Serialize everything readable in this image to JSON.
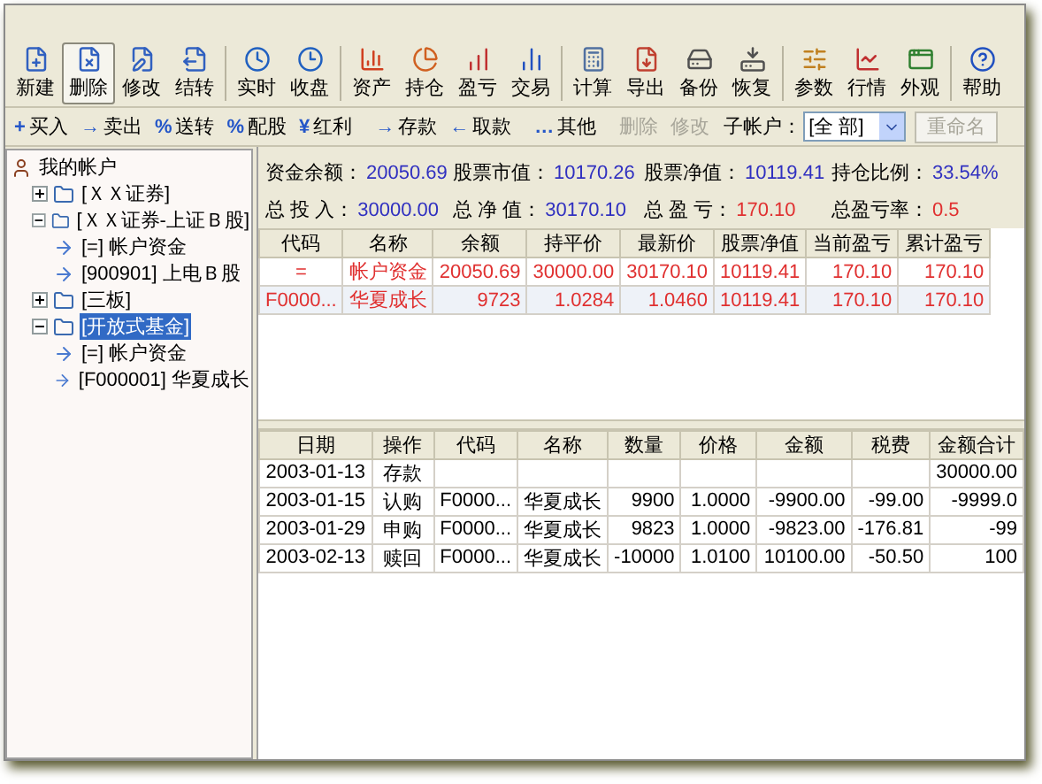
{
  "toolbar": [
    [
      {
        "label": "新建",
        "pressed": false
      },
      {
        "label": "删除",
        "pressed": true
      },
      {
        "label": "修改",
        "pressed": false
      },
      {
        "label": "结转",
        "pressed": false
      }
    ],
    [
      {
        "label": "实时",
        "pressed": false
      },
      {
        "label": "收盘",
        "pressed": false
      }
    ],
    [
      {
        "label": "资产",
        "pressed": false
      },
      {
        "label": "持仓",
        "pressed": false
      },
      {
        "label": "盈亏",
        "pressed": false
      },
      {
        "label": "交易",
        "pressed": false
      }
    ],
    [
      {
        "label": "计算",
        "pressed": false
      },
      {
        "label": "导出",
        "pressed": false
      },
      {
        "label": "备份",
        "pressed": false
      },
      {
        "label": "恢复",
        "pressed": false
      }
    ],
    [
      {
        "label": "参数",
        "pressed": false
      },
      {
        "label": "行情",
        "pressed": false
      },
      {
        "label": "外观",
        "pressed": false
      }
    ],
    [
      {
        "label": "帮助",
        "pressed": false
      }
    ]
  ],
  "actions": [
    [
      {
        "glyph": "+",
        "label": "买入",
        "disabled": false
      },
      {
        "glyph": "→",
        "label": "卖出",
        "disabled": false
      },
      {
        "glyph": "%",
        "label": "送转",
        "disabled": false
      },
      {
        "glyph": "%",
        "label": "配股",
        "disabled": false
      },
      {
        "glyph": "¥",
        "label": "红利",
        "disabled": false
      }
    ],
    [
      {
        "glyph": "→",
        "label": "存款",
        "disabled": false
      },
      {
        "glyph": "←",
        "label": "取款",
        "disabled": false
      }
    ],
    [
      {
        "glyph": "…",
        "label": "其他",
        "disabled": false
      }
    ],
    [
      {
        "label": "删除",
        "disabled": true
      },
      {
        "label": "修改",
        "disabled": true
      }
    ]
  ],
  "sub_account": {
    "label": "子帐户：",
    "value": "[全  部]",
    "rename": "重命名",
    "rename_disabled": true
  },
  "tree": [
    {
      "label": "我的帐户",
      "kind": "root",
      "selected": false,
      "children": [
        {
          "label": "[ＸＸ证券]",
          "kind": "account",
          "selected": false,
          "expanded": false
        },
        {
          "label": "[ＸＸ证券-上证Ｂ股]",
          "kind": "account",
          "selected": false,
          "expanded": true,
          "children": [
            {
              "label": "[=] 帐户资金",
              "kind": "item",
              "selected": false
            },
            {
              "label": "[900901] 上电Ｂ股",
              "kind": "item",
              "selected": false
            }
          ]
        },
        {
          "label": "[三板]",
          "kind": "account",
          "selected": false,
          "expanded": false
        },
        {
          "label": "[开放式基金]",
          "kind": "account",
          "selected": true,
          "expanded": true,
          "children": [
            {
              "label": "[=] 帐户资金",
              "kind": "item",
              "selected": false
            },
            {
              "label": "[F000001] 华夏成长",
              "kind": "item",
              "selected": false
            }
          ]
        }
      ]
    }
  ],
  "summary": [
    [
      {
        "label": "资金余额：",
        "value": "20050.69",
        "kind": "plain"
      },
      {
        "label": "股票市值：",
        "value": "10170.26",
        "kind": "plain"
      },
      {
        "label": "股票净值：",
        "value": "10119.41",
        "kind": "plain"
      },
      {
        "label": "持仓比例：",
        "value": "33.54%",
        "kind": "plain"
      }
    ],
    [
      {
        "label": "总 投 入：",
        "value": "30000.00",
        "kind": "plain"
      },
      {
        "label": "总 净 值：",
        "value": "30170.10",
        "kind": "plain"
      },
      {
        "label": "总 盈 亏：",
        "value": "170.10",
        "kind": "gain"
      },
      {
        "label": "总盈亏率：",
        "value": "0.5",
        "kind": "gain"
      }
    ]
  ],
  "holdings": {
    "columns": [
      "代码",
      "名称",
      "余额",
      "持平价",
      "最新价",
      "股票净值",
      "当前盈亏",
      "累计盈亏"
    ],
    "rows": [
      {
        "selected": false,
        "cells": [
          "=",
          "帐户资金",
          "20050.69",
          "30000.00",
          "30170.10",
          "10119.41",
          "170.10",
          "170.10"
        ]
      },
      {
        "selected": true,
        "cells": [
          "F0000...",
          "华夏成长",
          "9723",
          "1.0284",
          "1.0460",
          "10119.41",
          "170.10",
          "170.10"
        ]
      }
    ]
  },
  "transactions": {
    "columns": [
      "日期",
      "操作",
      "代码",
      "名称",
      "数量",
      "价格",
      "金额",
      "税费",
      "金额合计"
    ],
    "rows": [
      [
        "2003-01-13",
        "存款",
        "",
        "",
        "",
        "",
        "",
        "",
        "30000.00"
      ],
      [
        "2003-01-15",
        "认购",
        "F0000...",
        "华夏成长",
        "9900",
        "1.0000",
        "-9900.00",
        "-99.00",
        "-9999.0"
      ],
      [
        "2003-01-29",
        "申购",
        "F0000...",
        "华夏成长",
        "9823",
        "1.0000",
        "-9823.00",
        "-176.81",
        "-99"
      ],
      [
        "2003-02-13",
        "赎回",
        "F0000...",
        "华夏成长",
        "-10000",
        "1.0100",
        "10100.00",
        "-50.50",
        "100"
      ]
    ]
  }
}
